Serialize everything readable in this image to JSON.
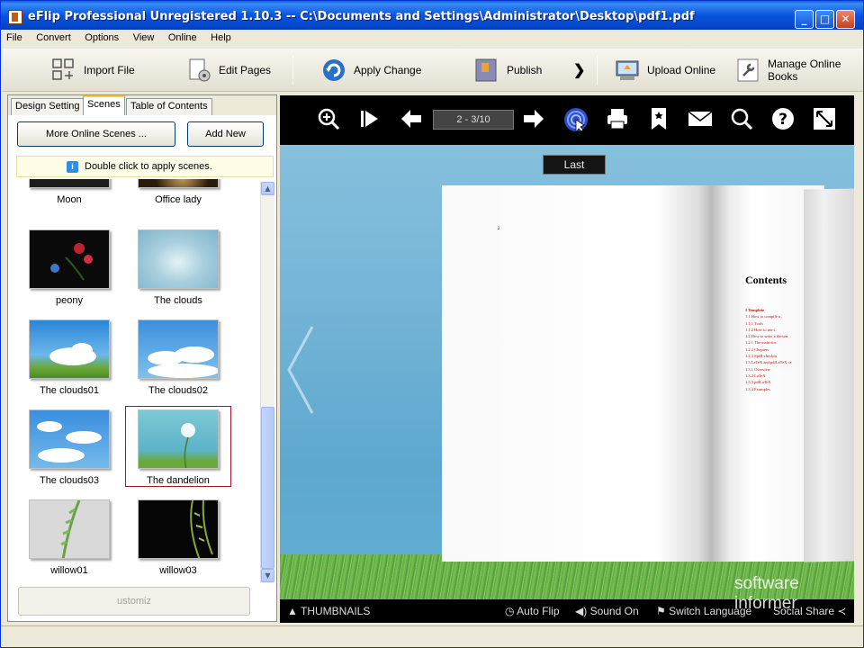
{
  "window": {
    "title": "eFlip Professional Unregistered 1.10.3  -- C:\\Documents and Settings\\Administrator\\Desktop\\pdf1.pdf",
    "minimize": "_",
    "maximize": "□",
    "close": "✕"
  },
  "menu": [
    "File",
    "Convert",
    "Options",
    "View",
    "Online",
    "Help"
  ],
  "toolbar": {
    "import_file": "Import File",
    "edit_pages": "Edit Pages",
    "apply_change": "Apply Change",
    "publish": "Publish",
    "more": "❯",
    "upload_online": "Upload Online",
    "manage_online_books": "Manage Online Books"
  },
  "left_panel": {
    "tabs": [
      "Design Setting",
      "Scenes",
      "Table of Contents"
    ],
    "active_tab": "Scenes",
    "more_online_scenes": "More Online Scenes ...",
    "add_new": "Add New",
    "hint": "Double click to apply scenes.",
    "hint_icon": "i",
    "scenes": [
      {
        "label": "Moon",
        "icon": "moon-scene"
      },
      {
        "label": "Office lady",
        "icon": "office-lady-scene"
      },
      {
        "label": "peony",
        "icon": "peony-scene"
      },
      {
        "label": "The clouds",
        "icon": "clouds-scene"
      },
      {
        "label": "The clouds01",
        "icon": "clouds01-scene"
      },
      {
        "label": "The clouds02",
        "icon": "clouds02-scene"
      },
      {
        "label": "The clouds03",
        "icon": "clouds03-scene"
      },
      {
        "label": "The dandelion",
        "icon": "dandelion-scene",
        "selected": true
      },
      {
        "label": "willow01",
        "icon": "willow01-scene"
      },
      {
        "label": "willow03",
        "icon": "willow03-scene"
      }
    ],
    "customize": "ustomiz"
  },
  "viewer": {
    "page_indicator": "2 - 3/10",
    "tooltip": "Last",
    "contents_title": "Contents",
    "page_marker": "2",
    "toc": [
      "1  Template",
      "   1.1  How to compile a .",
      "        1.1.1  Tools",
      "        1.1.2  How to use t",
      "   1.2  How to write a docum",
      "        1.2.1  The main doc",
      "        1.2.2  Chapters",
      "        1.2.3  Spell-checkin",
      "   1.3  LaTeX and pdfLaTeX ca",
      "        1.3.1  Overview",
      "        1.3.2  LaTeX",
      "        1.3.3  pdfLaTeX",
      "        1.3.4  Examples"
    ],
    "bottom": {
      "thumbnails": "THUMBNAILS",
      "auto_flip": "Auto Flip",
      "sound_on": "Sound On",
      "switch_language": "Switch Language",
      "social_share": "Social Share"
    },
    "watermark_line1": "software",
    "watermark_line2": "informer"
  },
  "colors": {
    "title_bar": "#0a54e0",
    "selected_border": "#a4162c",
    "toc_red": "#cc0000",
    "sky": "#6fb4d8"
  }
}
